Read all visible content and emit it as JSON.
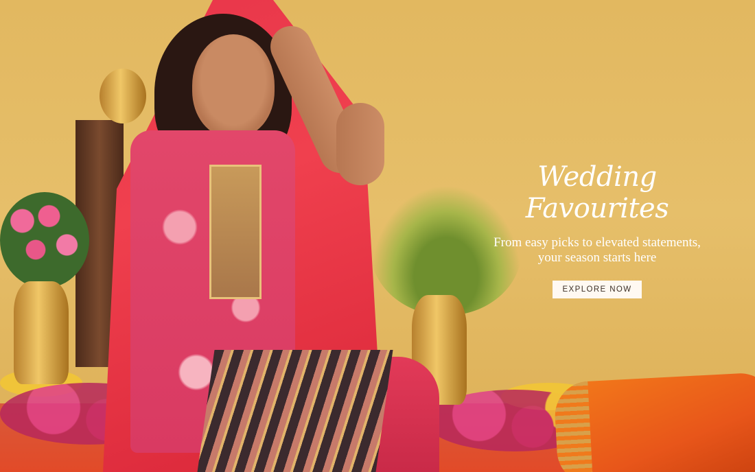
{
  "hero": {
    "title": "Wedding Favourites",
    "subtitle_line1": "From easy picks to elevated statements,",
    "subtitle_line2": "your season starts here",
    "cta_label": "EXPLORE NOW",
    "image": "model-in-pink-kurta-set-photo"
  },
  "colors": {
    "background": "#e2b860",
    "text": "#ffffff",
    "cta_background": "#fff9f2",
    "cta_text": "#3b2e25"
  }
}
